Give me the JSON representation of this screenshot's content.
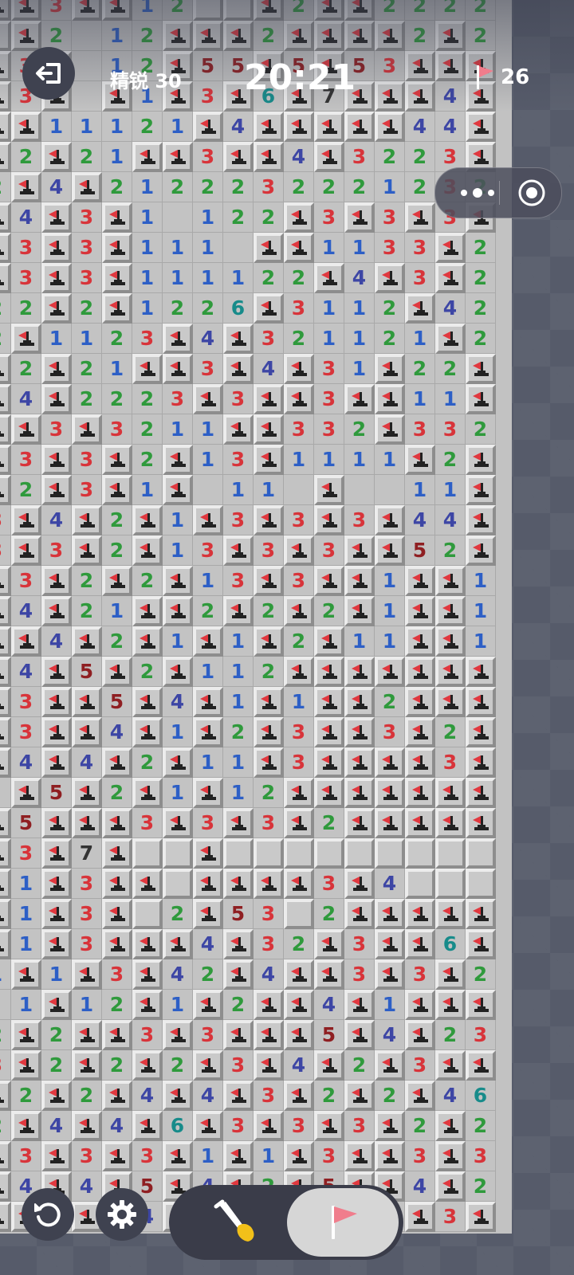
{
  "hud": {
    "difficulty_label": "精锐 30",
    "timer": "20:21",
    "flags_remaining": "26"
  },
  "icons": {
    "exit": "exit-icon",
    "flag_counter": "flag-icon",
    "more": "more-dots-icon",
    "close": "target-icon",
    "restart": "restart-icon",
    "settings": "gear-icon",
    "dig_mode": "shovel-icon",
    "flag_mode": "flag-icon"
  },
  "colors": {
    "n1": "#2d5fc6",
    "n2": "#2f9a3c",
    "n3": "#d8343a",
    "n4": "#3d46a5",
    "n5": "#8f1f22",
    "n6": "#178b8a",
    "n7": "#333333",
    "flag": "#e0383f"
  },
  "mode": {
    "selected": "flag"
  },
  "board": {
    "cols": 17,
    "rows": 41,
    "legend": "digits 1-8 = revealed number, 0 = revealed empty, F = flagged, C = covered",
    "grid": [
      "FF3FF12CCF2FF2222",
      "CF2012FFF2FFFF2F2",
      "F3F012F55F5F53FFF",
      "F3F0F1F3F6F7FFF4F",
      "FF11121F4FFFFF44F",
      "F2F21FF3FF4F3223F",
      "2F4F2122232221232",
      "F4F3F10122F3F3F3F",
      "F3F3F1110FF1133F2",
      "F3F3F111122F4F3F2",
      "22F2F1226F3112F42",
      "2F1123F4F321121F2",
      "F2F21FF3F4F31F22F",
      "F4F2223F3FF3FF11F",
      "FF3F3211FF332F332",
      "F3F3F2F13F1111F2F",
      "F2F3F1F0110F0011F",
      "3F4F2F1F3F3F3F44F",
      "3F3F2F13F3F3FF52F",
      "F3F2F2F13F3FF1FF1",
      "F4F21FF2F2F2F1FF1",
      "FF4F2F1F1F2F11FF1",
      "F4F5F2F112FFFFFFF",
      "F3FF5F4F1F1FF2FFF",
      "F3FF4F1F2F3FF3F2F",
      "F4F4F2F11F3FFFF3F",
      "0F5F2F1F12FFFFFFF",
      "F5FFF3F3F3F2FFFFF",
      "F3F7FCCFCCCCCCCCC",
      "F1F3FFCFFFF3F4CCC",
      "F1F3FC2F53C2FFFFF",
      "F1F3FFF4F32F3FF6F",
      "1F1F3F42F4FF3F3F2",
      "01F12F1F2FF4F1FFF",
      "2F2FF3F3FFF5F4F23",
      "3F2F2F2F3F4F2F3FF",
      "F2F2F4F4F3F2F2F46",
      "2F4F4F6F3F3F3F2F2",
      "F3F3F3F1F1F3FF3F3",
      "F4F4F5F4F2F5FF4F2",
      "FF3FF4F4F4F2F1F3F"
    ]
  }
}
